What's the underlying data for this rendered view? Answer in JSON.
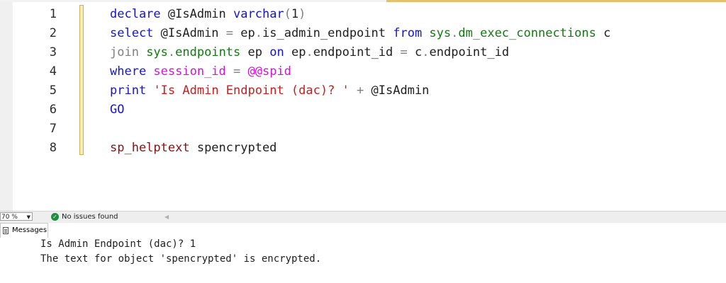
{
  "editor": {
    "line_numbers": [
      "1",
      "2",
      "3",
      "4",
      "5",
      "6",
      "7",
      "8"
    ],
    "lines": [
      [
        {
          "t": "declare",
          "c": "kw"
        },
        {
          "t": " @IsAdmin ",
          "c": "tx"
        },
        {
          "t": "varchar",
          "c": "kw"
        },
        {
          "t": "(",
          "c": "op"
        },
        {
          "t": "1",
          "c": "tx"
        },
        {
          "t": ")",
          "c": "op"
        }
      ],
      [
        {
          "t": "select",
          "c": "kw"
        },
        {
          "t": " @IsAdmin ",
          "c": "tx"
        },
        {
          "t": "=",
          "c": "op"
        },
        {
          "t": " ep",
          "c": "tx"
        },
        {
          "t": ".",
          "c": "op"
        },
        {
          "t": "is_admin_endpoint ",
          "c": "tx"
        },
        {
          "t": "from",
          "c": "kw"
        },
        {
          "t": " sys",
          "c": "sys"
        },
        {
          "t": ".",
          "c": "op"
        },
        {
          "t": "dm_exec_connections",
          "c": "sys"
        },
        {
          "t": " c",
          "c": "tx"
        }
      ],
      [
        {
          "t": "join",
          "c": "op"
        },
        {
          "t": " sys",
          "c": "sys"
        },
        {
          "t": ".",
          "c": "op"
        },
        {
          "t": "endpoints",
          "c": "sys"
        },
        {
          "t": " ep ",
          "c": "tx"
        },
        {
          "t": "on",
          "c": "kw"
        },
        {
          "t": " ep",
          "c": "tx"
        },
        {
          "t": ".",
          "c": "op"
        },
        {
          "t": "endpoint_id ",
          "c": "tx"
        },
        {
          "t": "=",
          "c": "op"
        },
        {
          "t": " c",
          "c": "tx"
        },
        {
          "t": ".",
          "c": "op"
        },
        {
          "t": "endpoint_id",
          "c": "tx"
        }
      ],
      [
        {
          "t": "where",
          "c": "kw"
        },
        {
          "t": " session_id",
          "c": "fn"
        },
        {
          "t": " = ",
          "c": "op"
        },
        {
          "t": "@@spid",
          "c": "fn"
        }
      ],
      [
        {
          "t": "print",
          "c": "kw"
        },
        {
          "t": " ",
          "c": "tx"
        },
        {
          "t": "'Is Admin Endpoint (dac)? '",
          "c": "str"
        },
        {
          "t": " + ",
          "c": "op"
        },
        {
          "t": "@IsAdmin",
          "c": "tx"
        }
      ],
      [
        {
          "t": "GO",
          "c": "kw"
        }
      ],
      [],
      [
        {
          "t": "sp_helptext",
          "c": "sp"
        },
        {
          "t": " spencrypted",
          "c": "tx"
        }
      ]
    ]
  },
  "status_bar": {
    "zoom": "70 %",
    "issues_text": "No issues found"
  },
  "results": {
    "tab_label": "Messages",
    "messages": [
      "Is Admin Endpoint (dac)? 1",
      "The text for object 'spencrypted' is encrypted."
    ]
  },
  "colors": {
    "keyword": "#1515d0",
    "system_object": "#127a12",
    "system_function": "#d312d3",
    "string": "#c91d1d",
    "stored_procedure": "#8a1010",
    "operator": "#7f7f7f"
  }
}
